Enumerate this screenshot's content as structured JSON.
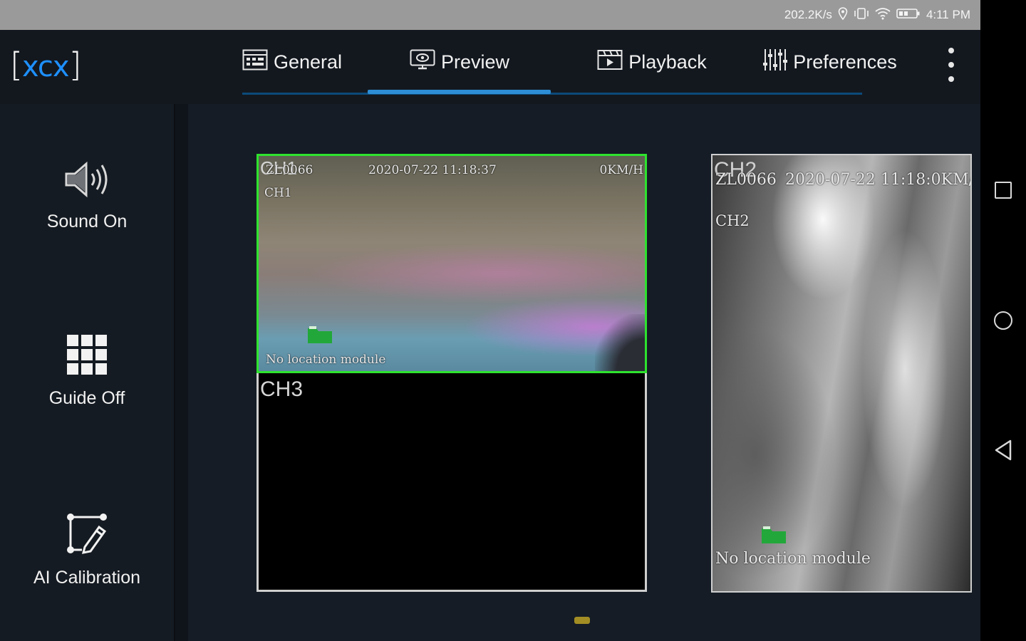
{
  "status_bar": {
    "network_speed": "202.2K/s",
    "time": "4:11 PM",
    "icons": [
      "location-icon",
      "vibrate-icon",
      "wifi-icon",
      "battery-icon"
    ]
  },
  "app": {
    "logo_bracket_left": "[",
    "logo_text": "xcx",
    "logo_bracket_right": "]",
    "accent_color": "#2d8ed6"
  },
  "tabs": [
    {
      "label": "General",
      "icon": "general-icon",
      "active": false
    },
    {
      "label": "Preview",
      "icon": "preview-icon",
      "active": true
    },
    {
      "label": "Playback",
      "icon": "playback-icon",
      "active": false
    },
    {
      "label": "Preferences",
      "icon": "preferences-icon",
      "active": false
    }
  ],
  "sidebar": {
    "items": [
      {
        "label": "Sound On",
        "icon": "speaker-icon"
      },
      {
        "label": "Guide Off",
        "icon": "grid-icon"
      },
      {
        "label": "AI Calibration",
        "icon": "calibration-icon"
      }
    ]
  },
  "channels": {
    "ch1": {
      "label": "CH1",
      "osd_plate": "ZL0066",
      "osd_timestamp": "2020-07-22 11:18:37",
      "osd_speed": "0KM/H",
      "osd_channel": "CH1",
      "osd_location": "No location module",
      "selected": true
    },
    "ch2": {
      "label": "CH2",
      "osd_plate": "ZL0066",
      "osd_timestamp": "2020-07-22 11:18:0KM/H",
      "osd_channel": "CH2",
      "osd_location": "No location module"
    },
    "ch3": {
      "label": "CH3"
    }
  },
  "nav_bar": {
    "buttons": [
      "recents-button",
      "home-button",
      "back-button"
    ]
  }
}
